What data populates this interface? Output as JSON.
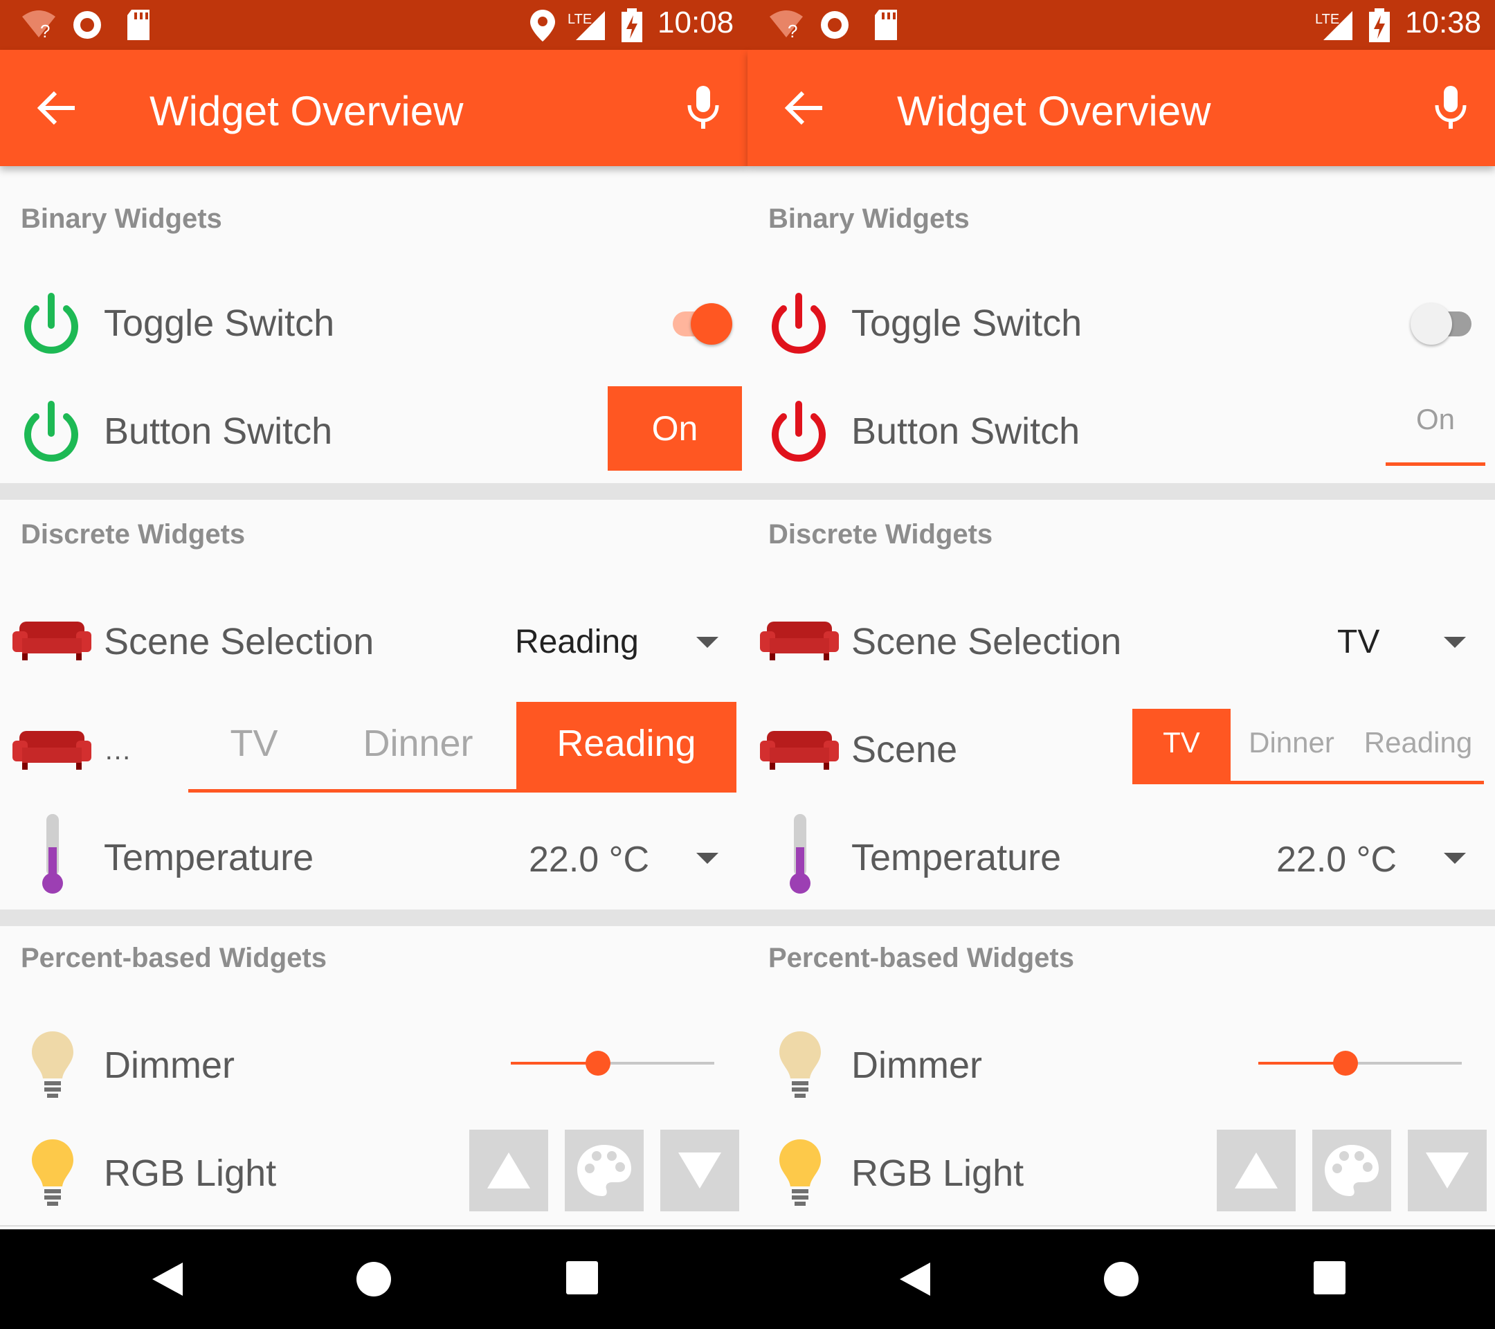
{
  "screens": [
    {
      "status": {
        "time": "10:08",
        "network": "LTE"
      },
      "appbar": {
        "title": "Widget Overview"
      },
      "binary": {
        "title": "Binary Widgets",
        "toggle": {
          "label": "Toggle Switch",
          "state": "on",
          "icon": "power-icon-green"
        },
        "button": {
          "label": "Button Switch",
          "value": "On",
          "state": "on",
          "icon": "power-icon-green"
        }
      },
      "discrete": {
        "title": "Discrete Widgets",
        "scene_selection": {
          "label": "Scene Selection",
          "value": "Reading",
          "icon": "sofa-icon"
        },
        "scene_buttons": {
          "label": "…",
          "options": [
            "TV",
            "Dinner",
            "Reading"
          ],
          "selected": "Reading",
          "icon": "sofa-icon"
        },
        "temperature": {
          "label": "Temperature",
          "value": "22.0 °C",
          "icon": "thermometer-icon"
        }
      },
      "percent": {
        "title": "Percent-based Widgets",
        "dimmer": {
          "label": "Dimmer",
          "level_percent": 43,
          "icon": "bulb-icon-dim"
        },
        "rgb": {
          "label": "RGB Light",
          "icon": "bulb-icon-yellow",
          "controls": [
            "up-arrow-icon",
            "palette-icon",
            "down-arrow-icon"
          ]
        }
      }
    },
    {
      "status": {
        "time": "10:38",
        "network": "LTE"
      },
      "appbar": {
        "title": "Widget Overview"
      },
      "binary": {
        "title": "Binary Widgets",
        "toggle": {
          "label": "Toggle Switch",
          "state": "off",
          "icon": "power-icon-red"
        },
        "button": {
          "label": "Button Switch",
          "value": "On",
          "state": "off",
          "icon": "power-icon-red"
        }
      },
      "discrete": {
        "title": "Discrete Widgets",
        "scene_selection": {
          "label": "Scene Selection",
          "value": "TV",
          "icon": "sofa-icon"
        },
        "scene_buttons": {
          "label": "Scene",
          "options": [
            "TV",
            "Dinner",
            "Reading"
          ],
          "selected": "TV",
          "icon": "sofa-icon"
        },
        "temperature": {
          "label": "Temperature",
          "value": "22.0 °C",
          "icon": "thermometer-icon"
        }
      },
      "percent": {
        "title": "Percent-based Widgets",
        "dimmer": {
          "label": "Dimmer",
          "level_percent": 43,
          "icon": "bulb-icon-dim"
        },
        "rgb": {
          "label": "RGB Light",
          "icon": "bulb-icon-yellow",
          "controls": [
            "up-arrow-icon",
            "palette-icon",
            "down-arrow-icon"
          ]
        }
      }
    }
  ],
  "colors": {
    "accent": "#ff5722",
    "status_bar": "#bf360c",
    "on_green": "#1db954",
    "off_red": "#e0121c",
    "sofa": "#b71c1c"
  }
}
